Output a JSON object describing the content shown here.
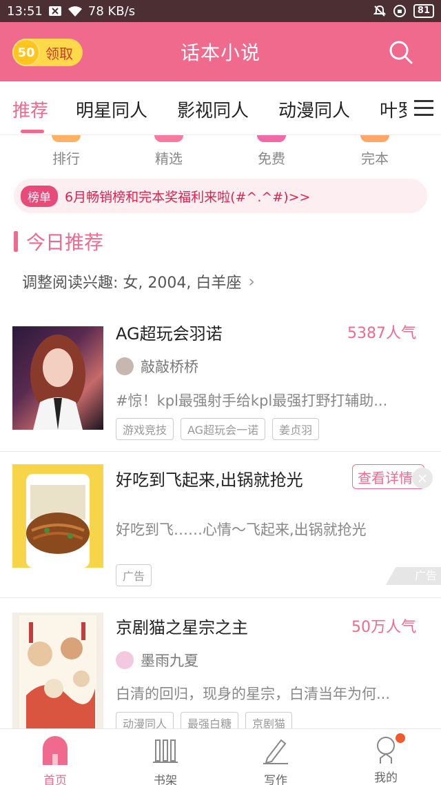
{
  "status_bar": {
    "time": "13:51",
    "net_speed": "78 KB/s",
    "battery": "81"
  },
  "header": {
    "title": "话本小说",
    "coin_amount": "50",
    "coin_label": "领取",
    "colors": {
      "brand": "#f06a8e",
      "coin": "#ffd94a"
    }
  },
  "tabs": [
    {
      "label": "推荐",
      "active": true
    },
    {
      "label": "明星同人"
    },
    {
      "label": "影视同人"
    },
    {
      "label": "动漫同人"
    },
    {
      "label": "叶罗"
    }
  ],
  "quick_nav": [
    {
      "label": "排行",
      "icon": "ranking-icon"
    },
    {
      "label": "精选",
      "icon": "featured-icon"
    },
    {
      "label": "免费",
      "icon": "free-icon"
    },
    {
      "label": "完本",
      "icon": "completed-icon"
    }
  ],
  "notice": {
    "badge": "榜单",
    "text": "6月畅销榜和完本奖福利来啦(#^.^#)>>"
  },
  "section": {
    "title": "今日推荐",
    "interest": "调整阅读兴趣: 女, 2004, 白羊座"
  },
  "books": [
    {
      "title": "AG超玩会羽诺",
      "popularity": "5387人气",
      "author": "敲敲桥桥",
      "desc": "#惊！kpl最强射手给kpl最强打野打辅助...",
      "tags": [
        "游戏竞技",
        "AG超玩会一诺",
        "姜贞羽"
      ]
    },
    {
      "title": "好吃到飞起来,出锅就抢光",
      "action": "查看详情",
      "desc": "好吃到飞……心情～飞起来,出锅就抢光",
      "tags": [
        "广告"
      ],
      "ad_label": "广告"
    },
    {
      "title": "京剧猫之星宗之主",
      "popularity": "50万人气",
      "author": "墨雨九夏",
      "desc": "白清的回归，现身的星宗，白清当年为何...",
      "tags": [
        "动漫同人",
        "最强白糖",
        "京剧猫"
      ]
    }
  ],
  "bottom_nav": [
    {
      "label": "首页",
      "icon": "home-icon",
      "active": true
    },
    {
      "label": "书架",
      "icon": "bookshelf-icon"
    },
    {
      "label": "写作",
      "icon": "pen-icon"
    },
    {
      "label": "我的",
      "icon": "profile-icon",
      "badge_dot": true
    }
  ]
}
